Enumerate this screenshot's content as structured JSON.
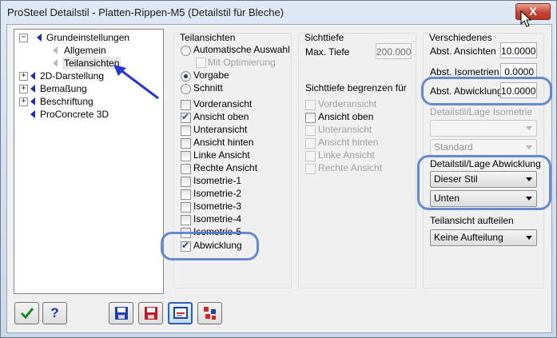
{
  "window": {
    "title": "ProSteel Detailstil - Platten-Rippen-M5 (Detailstil für Bleche)",
    "close_glyph": "X"
  },
  "tree": {
    "items": [
      {
        "label": "Grundeinstellungen",
        "expander": "−",
        "level": 0
      },
      {
        "label": "Allgemein",
        "level": 1
      },
      {
        "label": "Teilansichten",
        "level": 1,
        "selected": true
      },
      {
        "label": "2D-Darstellung",
        "expander": "+",
        "level": 0
      },
      {
        "label": "Bemaßung",
        "expander": "+",
        "level": 0
      },
      {
        "label": "Beschriftung",
        "expander": "+",
        "level": 0
      },
      {
        "label": "ProConcrete 3D",
        "level": 0
      }
    ]
  },
  "teilansichten": {
    "title": "Teilansichten",
    "auto": "Automatische Auswahl",
    "mit_optimierung": "Mit Optimierung",
    "vorgabe": "Vorgabe",
    "schnitt": "Schnitt",
    "checks": [
      {
        "label": "Vorderansicht",
        "checked": false
      },
      {
        "label": "Ansicht oben",
        "checked": true
      },
      {
        "label": "Unteransicht",
        "checked": false
      },
      {
        "label": "Ansicht hinten",
        "checked": false
      },
      {
        "label": "Linke Ansicht",
        "checked": false
      },
      {
        "label": "Rechte Ansicht",
        "checked": false
      },
      {
        "label": "Isometrie-1",
        "checked": false
      },
      {
        "label": "Isometrie-2",
        "checked": false
      },
      {
        "label": "Isometrie-3",
        "checked": false
      },
      {
        "label": "Isometrie-4",
        "checked": false
      },
      {
        "label": "Isometrie-5",
        "checked": false
      },
      {
        "label": "Abwicklung",
        "checked": true
      }
    ]
  },
  "sichttiefe": {
    "title": "Sichttiefe",
    "max_label": "Max. Tiefe",
    "max_value": "200.000",
    "begrenzen_title": "Sichttiefe begrenzen für",
    "checks": [
      {
        "label": "Vorderansicht",
        "enabled": false
      },
      {
        "label": "Ansicht oben",
        "enabled": true
      },
      {
        "label": "Unteransicht",
        "enabled": false
      },
      {
        "label": "Ansicht hinten",
        "enabled": false
      },
      {
        "label": "Linke Ansicht",
        "enabled": false
      },
      {
        "label": "Rechte Ansicht",
        "enabled": false
      }
    ]
  },
  "verschiedenes": {
    "title": "Verschiedenes",
    "ansichten_label": "Abst. Ansichten",
    "ansichten_value": "10.0000",
    "isometrien_label": "Abst. Isometrien",
    "isometrien_value": "0.0000",
    "abwicklung_label": "Abst. Abwicklung",
    "abwicklung_value": "10.0000",
    "iso_title": "Detailstil/Lage Isometrie",
    "iso_style": "",
    "iso_pos": "Standard",
    "abw_title": "Detailstil/Lage Abwicklung",
    "abw_style": "Dieser Stil",
    "abw_pos": "Unten",
    "aufteilen_title": "Teilansicht aufteilen",
    "aufteilen_value": "Keine Aufteilung"
  },
  "toolbar": {
    "ok_icon": "checkmark-icon",
    "help_glyph": "?",
    "icons": [
      "save-icon",
      "save-as-icon",
      "style-manager-icon",
      "palette-icon"
    ]
  },
  "accent_colors": {
    "tree_triangle": "#1c2db3",
    "highlight": "#4c78c8"
  }
}
